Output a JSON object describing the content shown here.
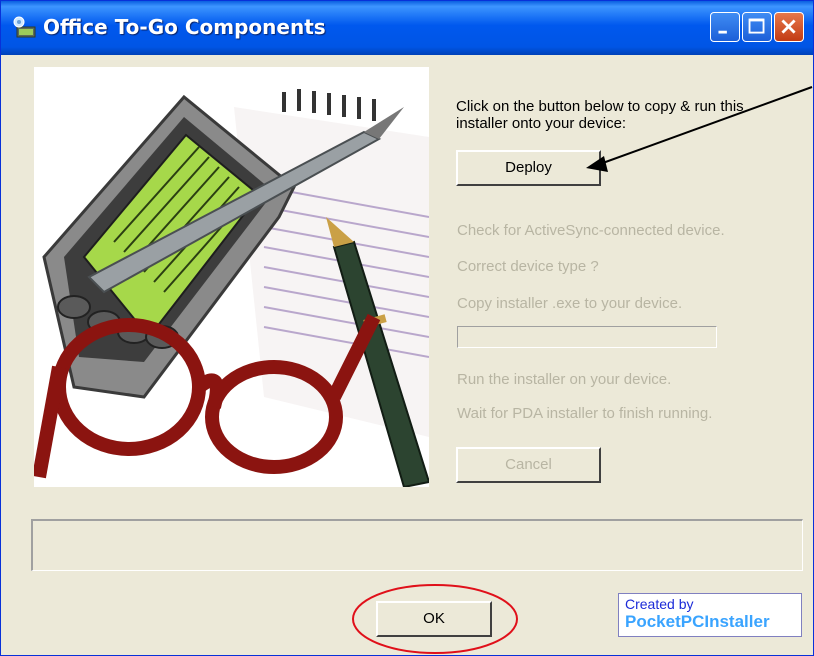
{
  "window": {
    "title": "Office To-Go Components",
    "icons": [
      "app-icon",
      "minimize-icon",
      "maximize-icon",
      "close-icon"
    ]
  },
  "main": {
    "instruction": "Click on the button below to copy & run this installer onto your device:",
    "deploy_label": "Deploy",
    "steps": [
      "Check for ActiveSync-connected device.",
      "Correct device type ?",
      "Copy installer .exe to your device.",
      "Run the installer on your device.",
      "Wait for PDA installer to finish running."
    ],
    "cancel_label": "Cancel",
    "ok_label": "OK",
    "message": ""
  },
  "credit": {
    "line1": "Created by",
    "line2": "PocketPCInstaller"
  },
  "colors": {
    "titlebar": "#0055e5",
    "disabled_text": "#b8b5a3",
    "annotation_arrow": "#000000",
    "annotation_circle": "#e0101a",
    "credit_blue": "#1c2bd8",
    "credit_light_blue": "#3aa4ff"
  }
}
